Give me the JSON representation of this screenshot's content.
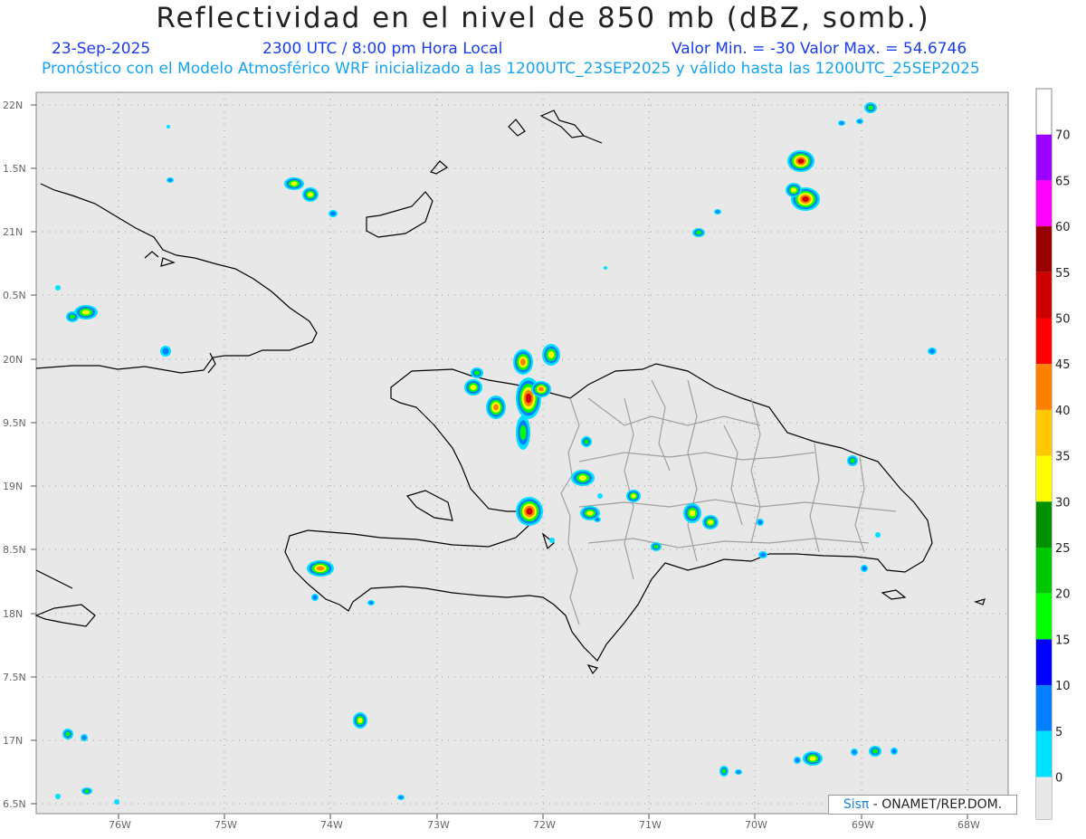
{
  "header": {
    "title": "Reflectividad en el nivel de 850 mb (dBZ, somb.)",
    "date": "23-Sep-2025",
    "time": "2300 UTC / 8:00 pm Hora Local",
    "minmax": "Valor Min. = -30  Valor Max. = 54.6746",
    "forecast": "Pronóstico con el Modelo Atmosférico WRF inicializado a las 1200UTC_23SEP2025 y válido hasta las  1200UTC_25SEP2025"
  },
  "axes": {
    "lat_labels": [
      "22N",
      "1.5N",
      "21N",
      "0.5N",
      "20N",
      "9.5N",
      "19N",
      "8.5N",
      "18N",
      "7.5N",
      "17N",
      "6.5N"
    ],
    "lon_labels": [
      "76W",
      "75W",
      "74W",
      "73W",
      "72W",
      "71W",
      "70W",
      "69W",
      "68W"
    ]
  },
  "colorbar": {
    "labels": [
      "70",
      "65",
      "60",
      "55",
      "50",
      "45",
      "40",
      "35",
      "30",
      "25",
      "20",
      "15",
      "10",
      "5",
      "0"
    ],
    "colors": [
      "#9900ff",
      "#ff00ff",
      "#990000",
      "#cc0000",
      "#ff0000",
      "#ff8000",
      "#ffc800",
      "#ffff00",
      "#009000",
      "#00c800",
      "#00ff00",
      "#0000ff",
      "#0080ff",
      "#00e0ff",
      "#e8e8e8"
    ]
  },
  "credit": {
    "brand": "Sisπ",
    "text": "- ONAMET/REP.DOM."
  }
}
